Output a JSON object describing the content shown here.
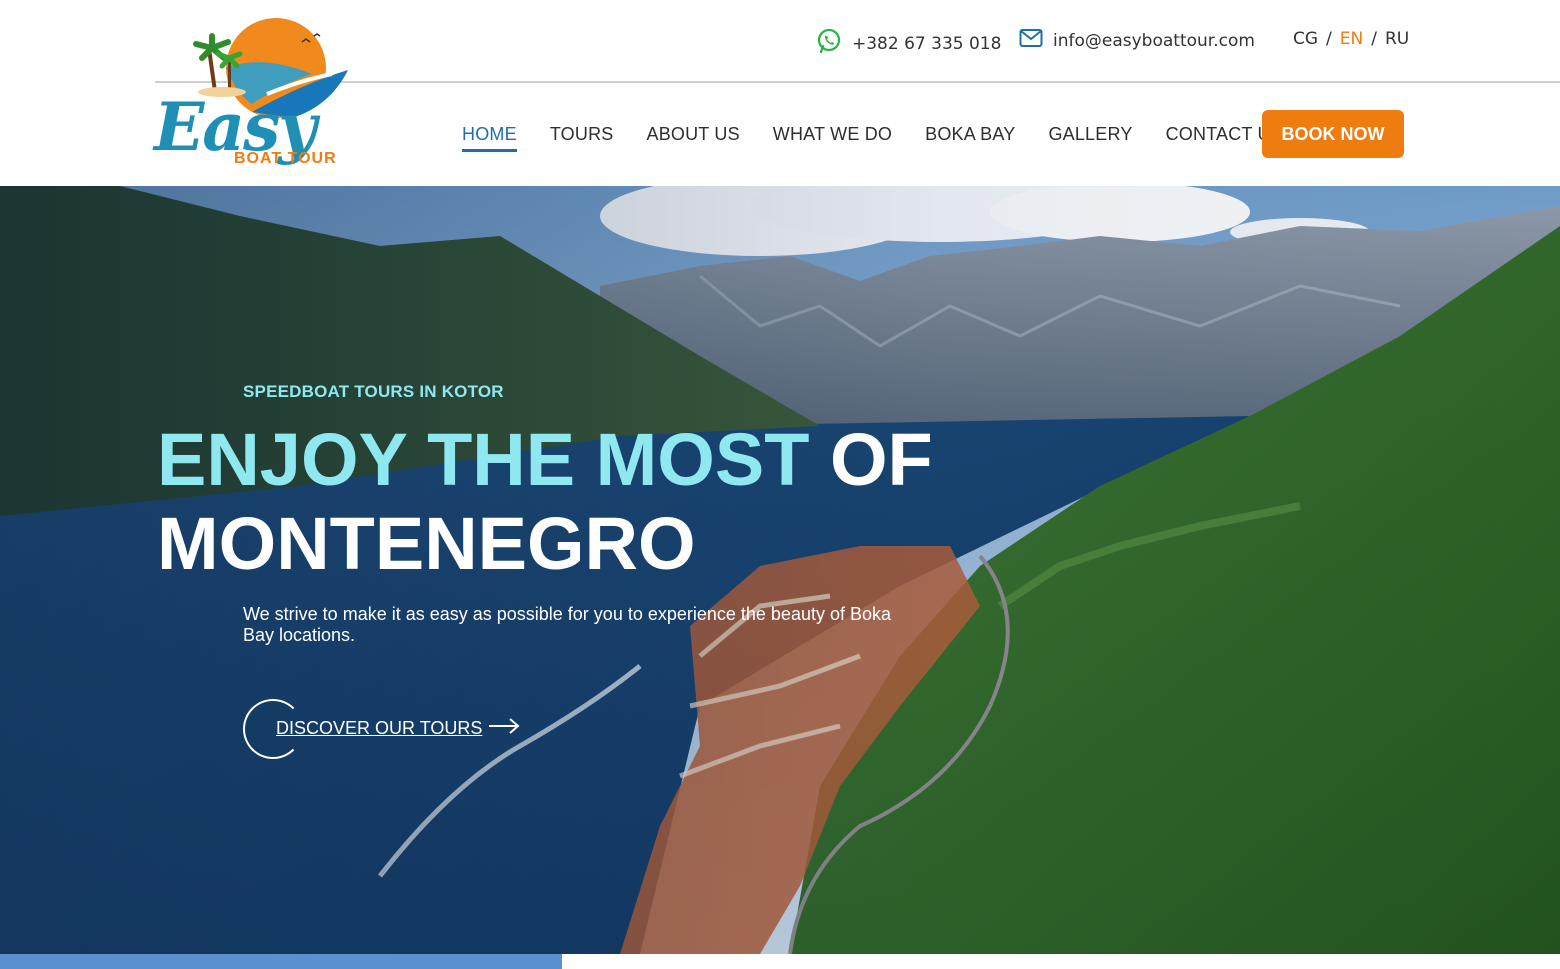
{
  "header": {
    "phone": "+382 67 335 018",
    "email": "info@easyboattour.com",
    "languages": [
      {
        "code": "CG",
        "active": false
      },
      {
        "code": "EN",
        "active": true
      },
      {
        "code": "RU",
        "active": false
      }
    ],
    "lang_separator": "/",
    "icons": {
      "phone": "whatsapp-icon",
      "email": "mail-icon"
    }
  },
  "logo": {
    "word": "Easy",
    "sub": "BOAT TOUR"
  },
  "nav": {
    "items": [
      {
        "label": "HOME",
        "active": true
      },
      {
        "label": "TOURS",
        "active": false
      },
      {
        "label": "ABOUT US",
        "active": false
      },
      {
        "label": "WHAT WE DO",
        "active": false
      },
      {
        "label": "BOKA BAY",
        "active": false
      },
      {
        "label": "GALLERY",
        "active": false
      },
      {
        "label": "CONTACT US",
        "active": false
      }
    ],
    "cta": "BOOK NOW"
  },
  "hero": {
    "eyebrow": "SPEEDBOAT TOURS IN KOTOR",
    "headline_highlight": "ENJOY THE MOST",
    "headline_rest_line1": "OF",
    "headline_line2": "MONTENEGRO",
    "subtitle": "We strive to make it as easy as possible for you to experience the beauty of Boka Bay locations.",
    "cta_label": "DISCOVER OUR TOURS",
    "cta_arrow": "⟶"
  },
  "colors": {
    "accent": "#ee7c0f",
    "brand_blue": "#1f6fa6",
    "hero_highlight": "#8fe8f0"
  }
}
